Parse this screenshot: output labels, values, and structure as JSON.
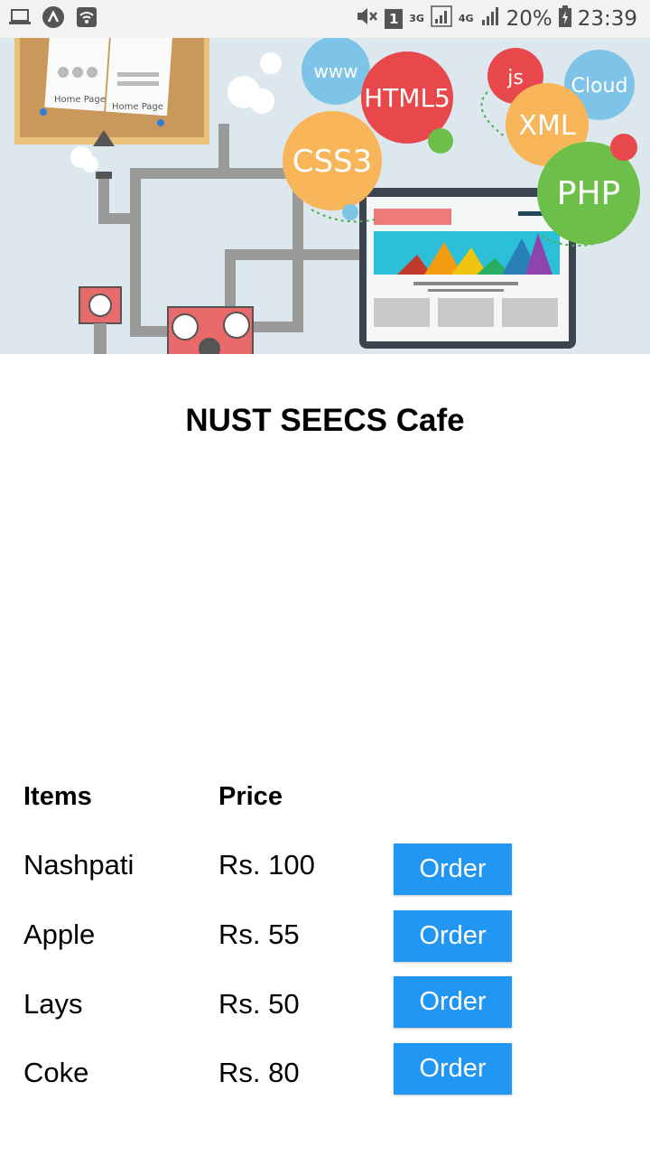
{
  "status_bar": {
    "network_4g": "4G",
    "network_3g": "3G",
    "sim_slot": "1",
    "battery_percent": "20%",
    "time": "23:39"
  },
  "banner": {
    "bubbles": [
      "www",
      "HTML5",
      "CSS3",
      "js",
      "XML",
      "Cloud",
      "PHP"
    ],
    "board_labels": [
      "Home Page",
      "Home Page"
    ]
  },
  "page": {
    "title": "NUST SEECS Cafe"
  },
  "menu": {
    "headers": {
      "items": "Items",
      "price": "Price"
    },
    "rows": [
      {
        "item": "Nashpati",
        "price": "Rs. 100",
        "action": "Order"
      },
      {
        "item": "Apple",
        "price": "Rs. 55",
        "action": "Order"
      },
      {
        "item": "Lays",
        "price": "Rs. 50",
        "action": "Order"
      },
      {
        "item": "Coke",
        "price": "Rs. 80",
        "action": "Order"
      }
    ]
  },
  "colors": {
    "order_button": "#2196f3",
    "banner_background": "#dde7ee"
  }
}
